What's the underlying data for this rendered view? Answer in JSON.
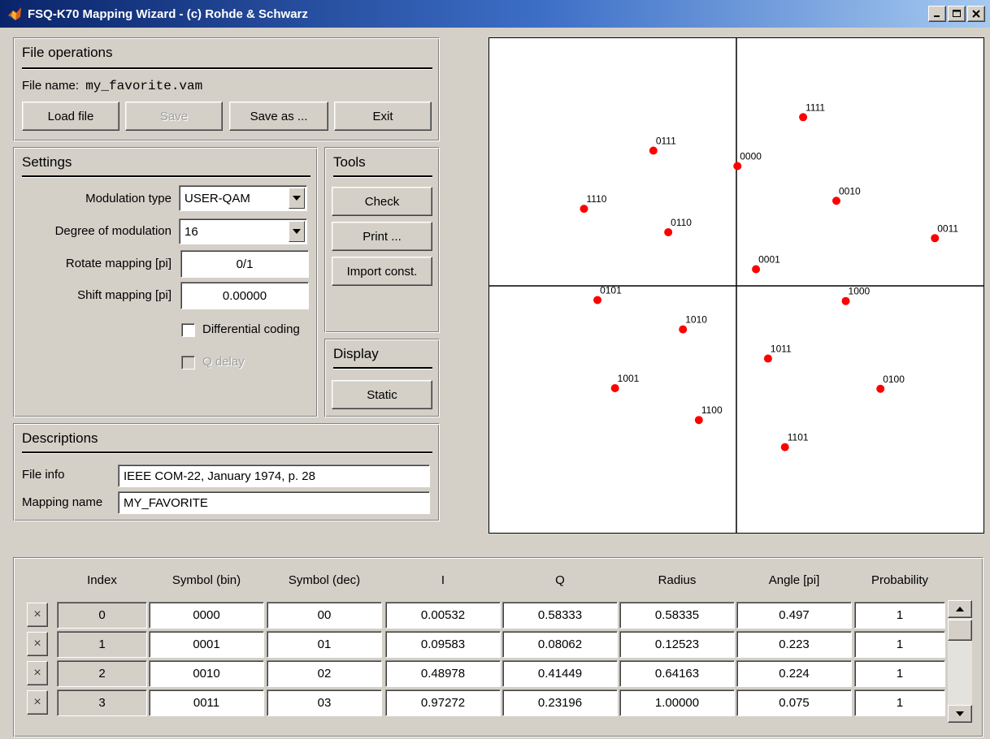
{
  "window": {
    "title": "FSQ-K70 Mapping Wizard  -  (c) Rohde & Schwarz",
    "minimize_glyph": "_",
    "maximize_glyph": "□",
    "close_glyph": "X"
  },
  "file_operations": {
    "title": "File operations",
    "file_name_label": "File name:",
    "file_name": "my_favorite.vam",
    "buttons": {
      "load": "Load file",
      "save": "Save",
      "save_as": "Save as ...",
      "exit": "Exit"
    }
  },
  "settings": {
    "title": "Settings",
    "modulation_type_label": "Modulation type",
    "modulation_type": "USER-QAM",
    "degree_label": "Degree of modulation",
    "degree": "16",
    "rotate_label": "Rotate mapping [pi]",
    "rotate": "0/1",
    "shift_label": "Shift mapping [pi]",
    "shift": "0.00000",
    "differential_label": "Differential coding",
    "differential_checked": false,
    "qdelay_label": "Q delay",
    "qdelay_checked": false,
    "qdelay_enabled": false
  },
  "tools": {
    "title": "Tools",
    "buttons": {
      "check": "Check",
      "print": "Print ...",
      "import": "Import const."
    }
  },
  "display": {
    "title": "Display",
    "button": "Static"
  },
  "descriptions": {
    "title": "Descriptions",
    "file_info_label": "File info",
    "file_info": "IEEE COM-22, January 1974, p. 28",
    "mapping_name_label": "Mapping name",
    "mapping_name": "MY_FAVORITE"
  },
  "chart_data": {
    "type": "scatter",
    "title": "",
    "xlabel": "",
    "ylabel": "",
    "xlim": [
      -1.0,
      1.0
    ],
    "ylim": [
      -1.0,
      1.0
    ],
    "grid": false,
    "axes": "crosshair at origin",
    "marker_color": "#ff0000",
    "points": [
      {
        "label": "0000",
        "x": 0.005,
        "y": 0.583
      },
      {
        "label": "0001",
        "x": 0.096,
        "y": 0.081
      },
      {
        "label": "0010",
        "x": 0.49,
        "y": 0.414
      },
      {
        "label": "0011",
        "x": 0.973,
        "y": 0.232
      },
      {
        "label": "0100",
        "x": 0.706,
        "y": -0.501
      },
      {
        "label": "0101",
        "x": -0.681,
        "y": -0.069
      },
      {
        "label": "0110",
        "x": -0.334,
        "y": 0.261
      },
      {
        "label": "0111",
        "x": -0.407,
        "y": 0.658
      },
      {
        "label": "1000",
        "x": 0.536,
        "y": -0.074
      },
      {
        "label": "1001",
        "x": -0.595,
        "y": -0.498
      },
      {
        "label": "1010",
        "x": -0.262,
        "y": -0.212
      },
      {
        "label": "1011",
        "x": 0.155,
        "y": -0.354
      },
      {
        "label": "1100",
        "x": -0.184,
        "y": -0.653
      },
      {
        "label": "1101",
        "x": 0.238,
        "y": -0.785
      },
      {
        "label": "1110",
        "x": -0.747,
        "y": 0.375
      },
      {
        "label": "1111",
        "x": 0.327,
        "y": 0.821
      }
    ]
  },
  "table": {
    "headers": [
      "Index",
      "Symbol (bin)",
      "Symbol (dec)",
      "I",
      "Q",
      "Radius",
      "Angle [pi]",
      "Probability"
    ],
    "delete_glyph": "×",
    "rows": [
      [
        "0",
        "0000",
        "00",
        "0.00532",
        "0.58333",
        "0.58335",
        "0.497",
        "1"
      ],
      [
        "1",
        "0001",
        "01",
        "0.09583",
        "0.08062",
        "0.12523",
        "0.223",
        "1"
      ],
      [
        "2",
        "0010",
        "02",
        "0.48978",
        "0.41449",
        "0.64163",
        "0.224",
        "1"
      ],
      [
        "3",
        "0011",
        "03",
        "0.97272",
        "0.23196",
        "1.00000",
        "0.075",
        "1"
      ]
    ]
  },
  "colors": {
    "window_face": "#d4d0c8",
    "titlebar_start": "#0a246a",
    "titlebar_end": "#a6caf0",
    "marker": "#ff0000"
  }
}
